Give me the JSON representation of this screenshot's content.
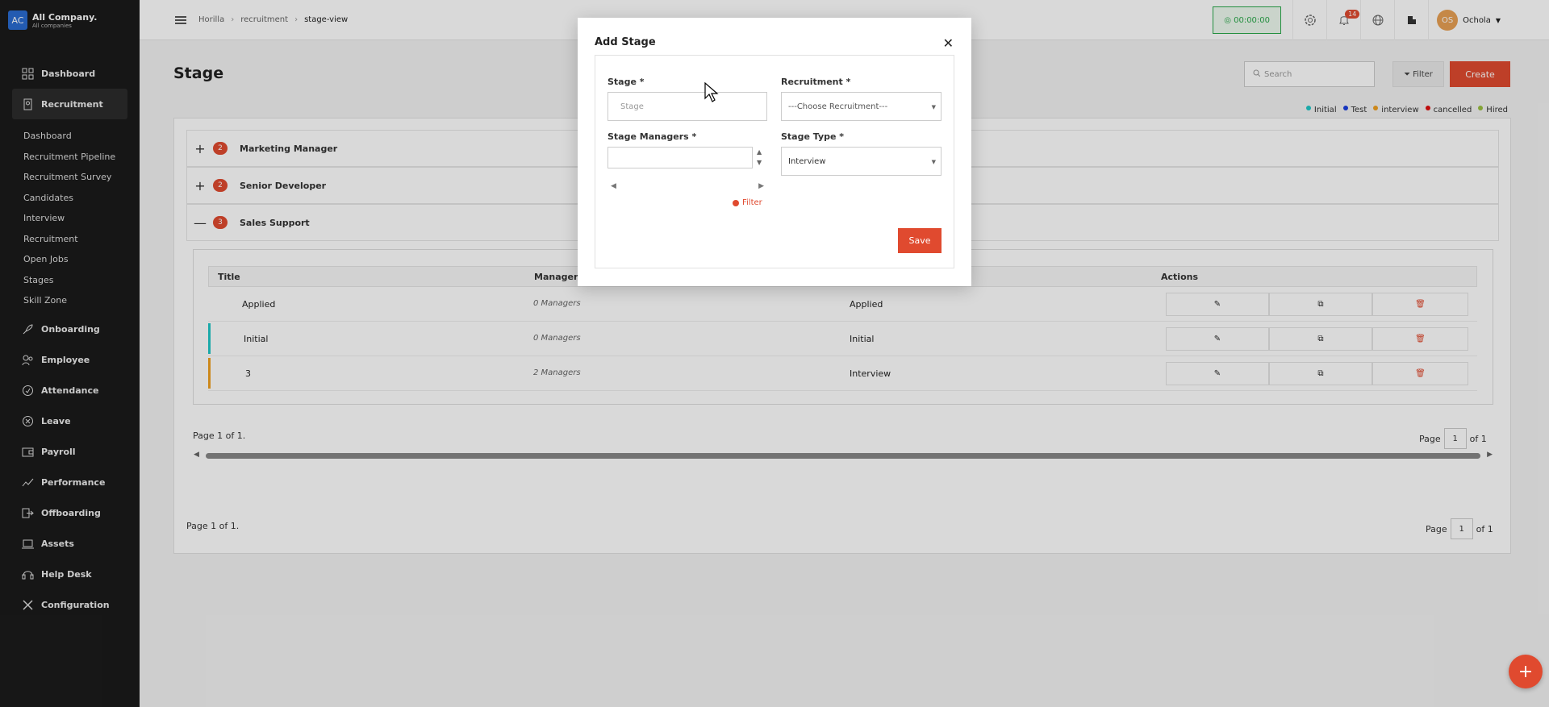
{
  "company": {
    "logo": "AC",
    "name": "All Company.",
    "sub": "All companies"
  },
  "nav": [
    {
      "label": "Dashboard",
      "icon": "dashboard-icon"
    },
    {
      "label": "Recruitment",
      "icon": "recruitment-icon",
      "active": true
    },
    {
      "label": "Onboarding",
      "icon": "rocket-icon"
    },
    {
      "label": "Employee",
      "icon": "people-icon"
    },
    {
      "label": "Attendance",
      "icon": "check-circle-icon"
    },
    {
      "label": "Leave",
      "icon": "x-circle-icon"
    },
    {
      "label": "Payroll",
      "icon": "wallet-icon"
    },
    {
      "label": "Performance",
      "icon": "trend-icon"
    },
    {
      "label": "Offboarding",
      "icon": "exit-icon"
    },
    {
      "label": "Assets",
      "icon": "laptop-icon"
    },
    {
      "label": "Help Desk",
      "icon": "headset-icon"
    },
    {
      "label": "Configuration",
      "icon": "tools-icon"
    }
  ],
  "subnav": [
    "Dashboard",
    "Recruitment Pipeline",
    "Recruitment Survey",
    "Candidates",
    "Interview",
    "Recruitment",
    "Open Jobs",
    "Stages",
    "Skill Zone"
  ],
  "breadcrumb": [
    "Horilla",
    "recruitment",
    "stage-view"
  ],
  "header": {
    "timer": "00:00:00",
    "notifications": "14",
    "user": "Ochola",
    "user_initials": "OS"
  },
  "page": {
    "title": "Stage",
    "search_placeholder": "Search",
    "filter": "Filter",
    "create": "Create"
  },
  "legend": [
    {
      "label": "Initial",
      "color": "#1fc7c7"
    },
    {
      "label": "Test",
      "color": "#1a3fe0"
    },
    {
      "label": "interview",
      "color": "#f0a020"
    },
    {
      "label": "cancelled",
      "color": "#e01010"
    },
    {
      "label": "Hired",
      "color": "#9ac040"
    }
  ],
  "groups": [
    {
      "count": "2",
      "name": "Marketing Manager",
      "expanded": false
    },
    {
      "count": "2",
      "name": "Senior Developer",
      "expanded": false
    },
    {
      "count": "3",
      "name": "Sales Support",
      "expanded": true
    }
  ],
  "table": {
    "headers": {
      "title": "Title",
      "managers": "Managers",
      "actions": "Actions"
    },
    "rows": [
      {
        "title": "Applied",
        "managers": "0 Managers",
        "type": "Applied",
        "bar": ""
      },
      {
        "title": "Initial",
        "managers": "0 Managers",
        "type": "Initial",
        "bar": "#1fc7c7"
      },
      {
        "title": "3",
        "managers": "2 Managers",
        "type": "Interview",
        "bar": "#f0a020"
      }
    ]
  },
  "pager_inner": {
    "text": "Page 1 of 1.",
    "label": "Page",
    "value": "1",
    "of": "of 1"
  },
  "pager_outer": {
    "text": "Page 1 of 1.",
    "label": "Page",
    "value": "1",
    "of": "of 1"
  },
  "modal": {
    "title": "Add Stage",
    "stage_label": "Stage *",
    "stage_placeholder": "Stage",
    "recruitment_label": "Recruitment *",
    "recruitment_value": "---Choose Recruitment---",
    "managers_label": "Stage Managers *",
    "type_label": "Stage Type *",
    "type_value": "Interview",
    "filter": "Filter",
    "save": "Save"
  }
}
